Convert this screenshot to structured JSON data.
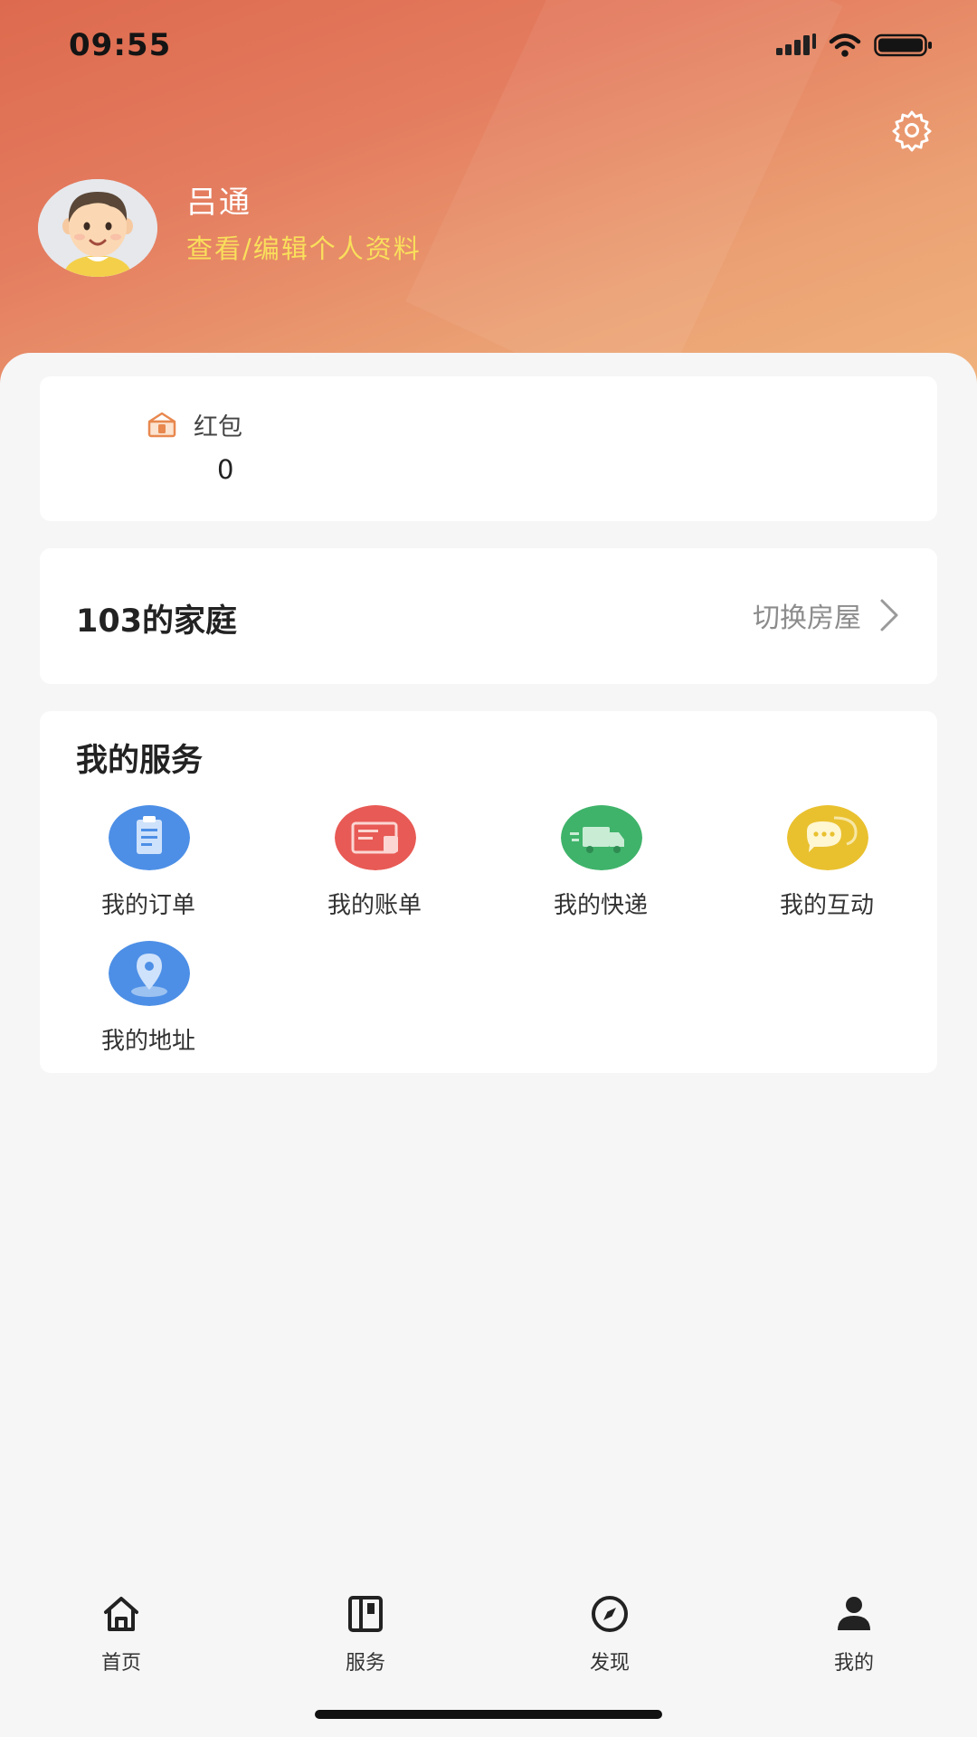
{
  "status_bar": {
    "time": "09:55"
  },
  "profile": {
    "name": "吕通",
    "edit_link": "查看/编辑个人资料"
  },
  "red_packet": {
    "label": "红包",
    "value": "0"
  },
  "family": {
    "name": "103的家庭",
    "switch_label": "切换房屋"
  },
  "services": {
    "title": "我的服务",
    "items": [
      {
        "label": "我的订单",
        "icon": "order-icon",
        "color": "#4d8fe6"
      },
      {
        "label": "我的账单",
        "icon": "bill-icon",
        "color": "#e85a55"
      },
      {
        "label": "我的快递",
        "icon": "delivery-truck-icon",
        "color": "#3fb36a"
      },
      {
        "label": "我的互动",
        "icon": "chat-bubble-icon",
        "color": "#e9c12f"
      },
      {
        "label": "我的地址",
        "icon": "location-pin-icon",
        "color": "#4d8fe6"
      }
    ]
  },
  "tabbar": {
    "items": [
      {
        "label": "首页",
        "icon": "home-icon"
      },
      {
        "label": "服务",
        "icon": "service-icon"
      },
      {
        "label": "发现",
        "icon": "compass-icon"
      },
      {
        "label": "我的",
        "icon": "person-icon",
        "active": true
      }
    ]
  },
  "colors": {
    "header_start": "#dd6a4e",
    "header_end": "#f0b27d",
    "edit_link": "#f9df5b"
  }
}
